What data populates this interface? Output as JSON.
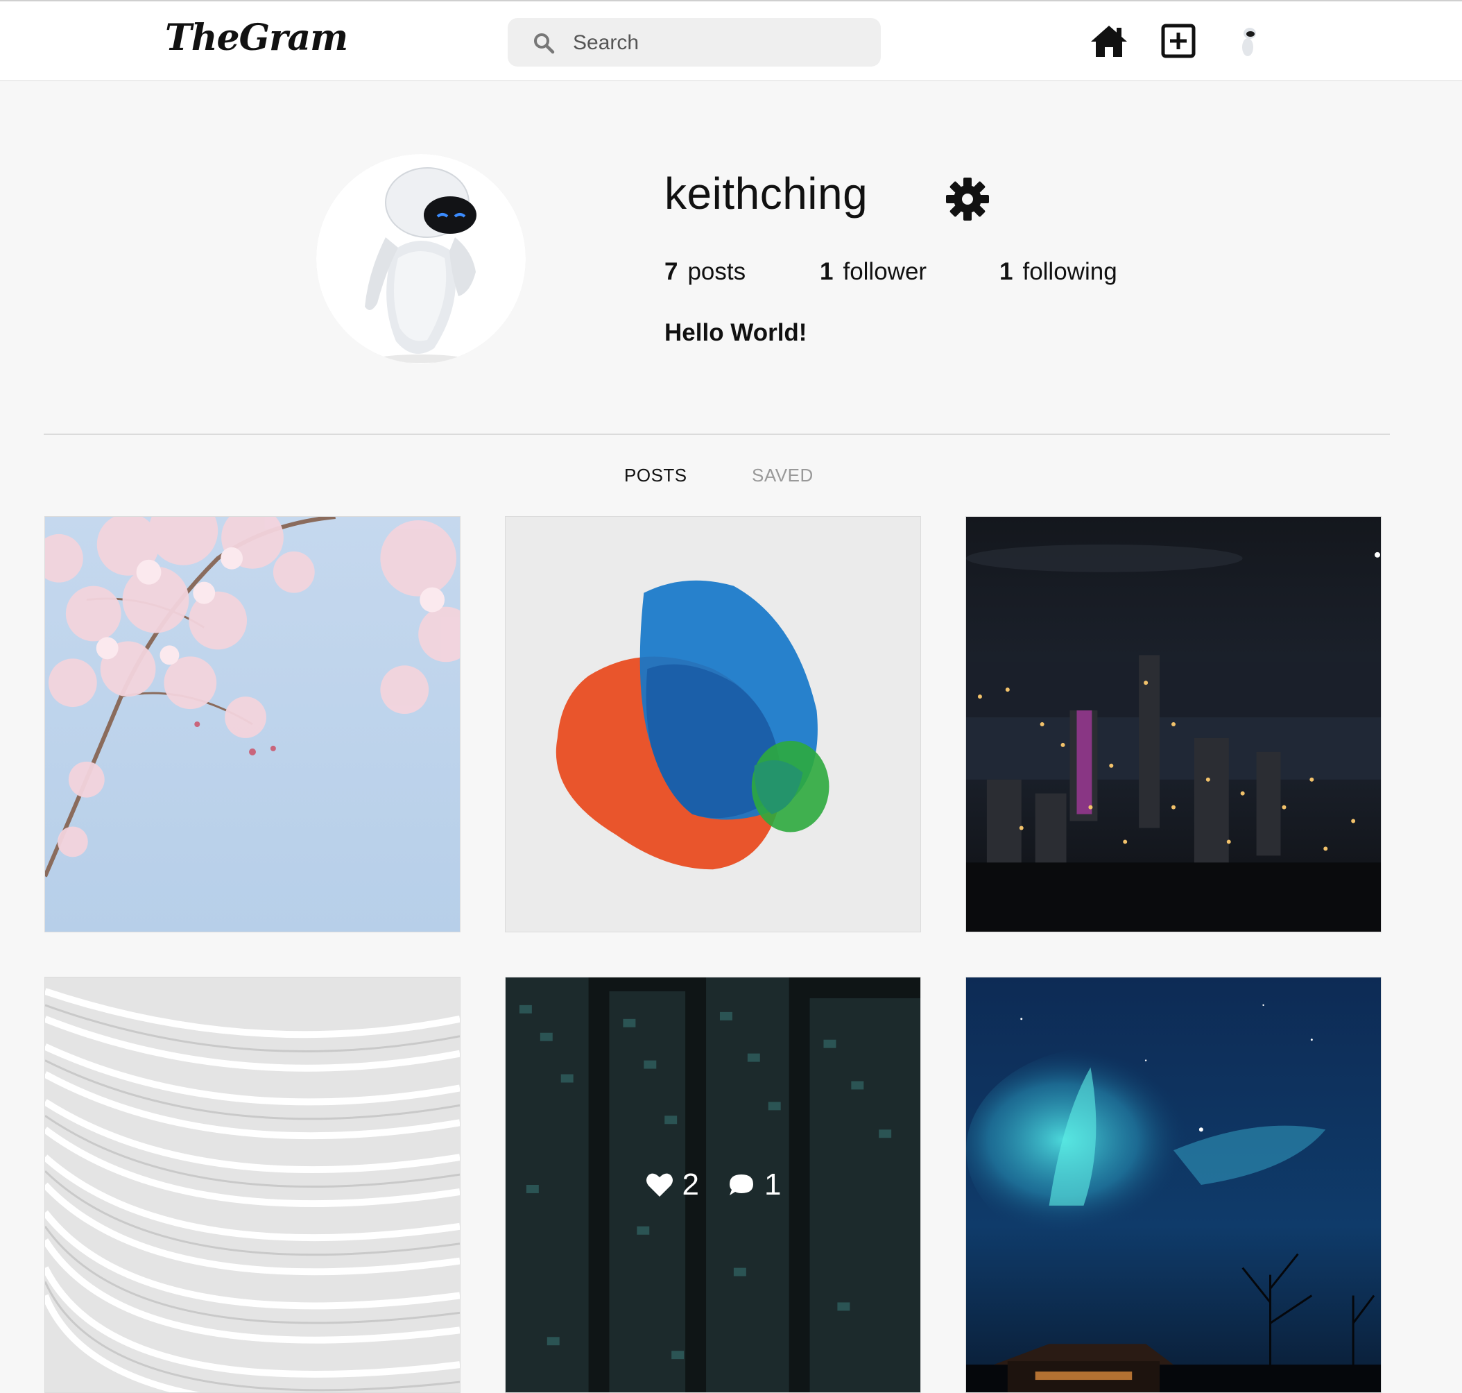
{
  "app": {
    "logo_text": "TheGram"
  },
  "header": {
    "search_placeholder": "Search",
    "icons": [
      "home-icon",
      "new-post-icon",
      "profile-avatar"
    ]
  },
  "profile": {
    "username": "keithching",
    "posts_count": "7",
    "posts_label": "posts",
    "followers_count": "1",
    "followers_label": "follower",
    "following_count": "1",
    "following_label": "following",
    "bio": "Hello World!"
  },
  "tabs": {
    "posts": "POSTS",
    "saved": "SAVED"
  },
  "grid": {
    "hovered_post": {
      "likes": "2",
      "comments": "1"
    }
  },
  "colors": {
    "background": "#f7f7f7",
    "header": "#ffffff",
    "active_tab": "#111111",
    "inactive_tab": "#999999"
  }
}
